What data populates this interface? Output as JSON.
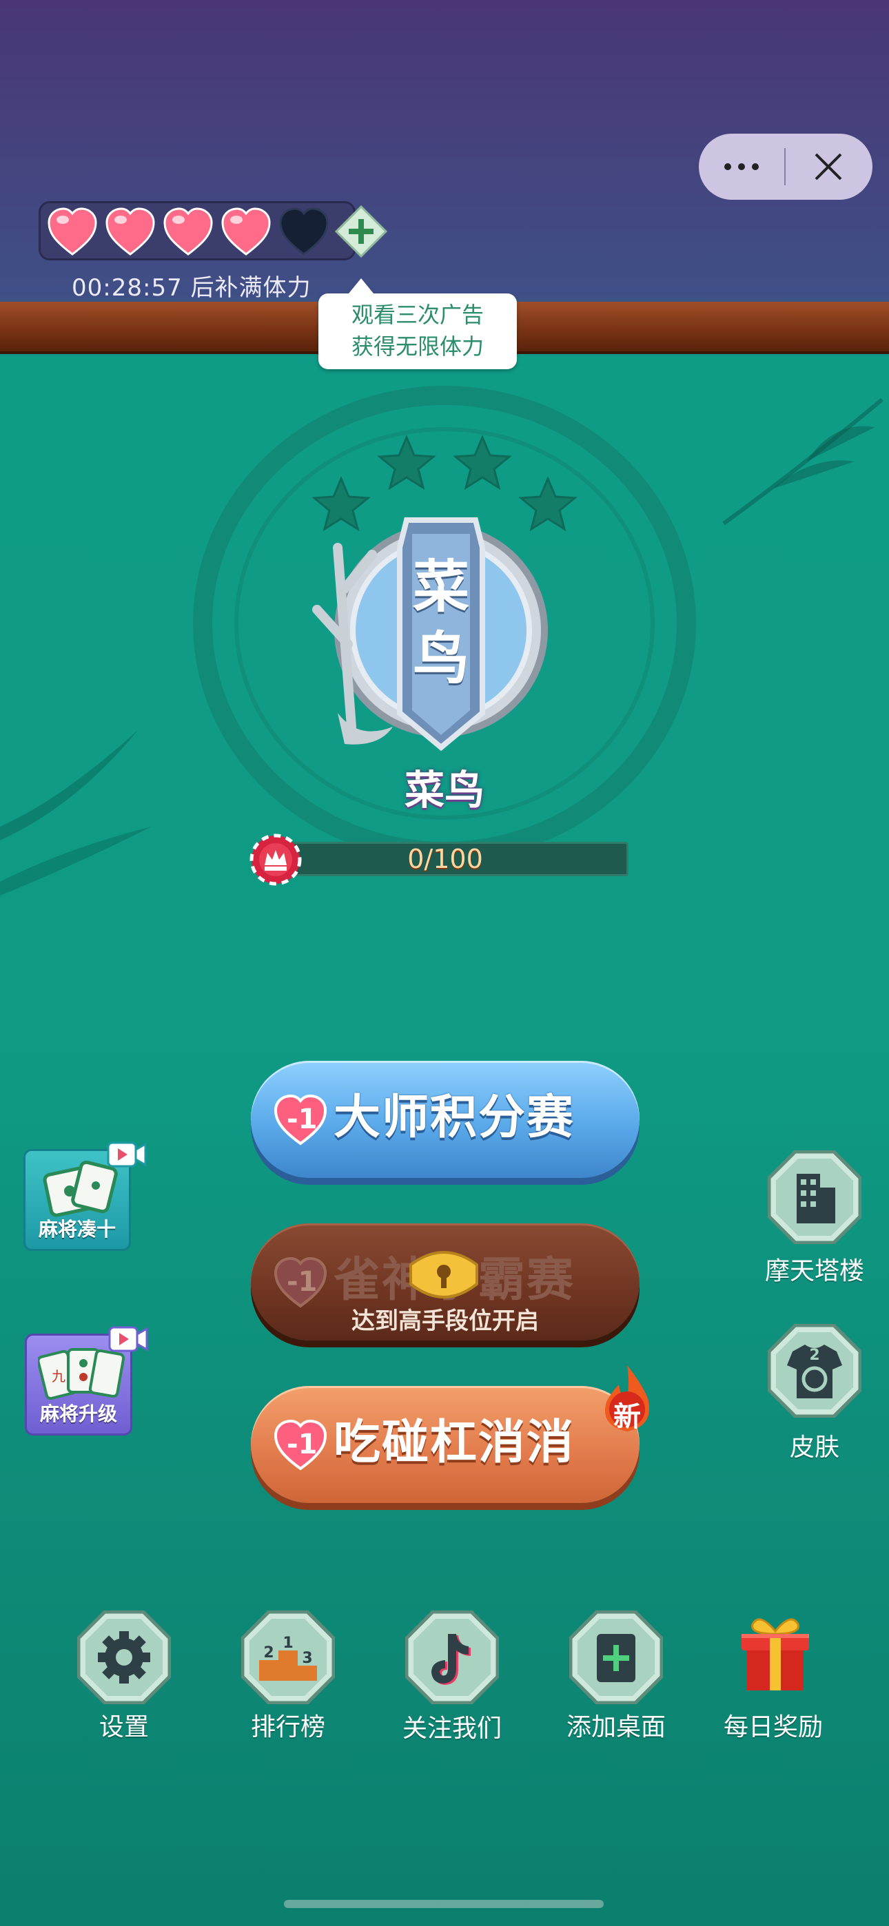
{
  "header": {
    "lives_full": 4,
    "lives_total": 5,
    "timer_text": "00:28:57 后补满体力",
    "tooltip_line1": "观看三次广告",
    "tooltip_line2": "获得无限体力"
  },
  "rank": {
    "badge_text": "菜鸟",
    "name": "菜鸟",
    "stars_total": 4,
    "stars_filled": 0,
    "progress_text": "0/100",
    "progress_value": 0
  },
  "main_buttons": {
    "master": {
      "label": "大师积分赛",
      "cost": "-1"
    },
    "locked": {
      "label": "雀神争霸赛",
      "cost": "-1",
      "sub": "达到高手段位开启"
    },
    "chi_peng": {
      "label": "吃碰杠消消",
      "cost": "-1",
      "badge": "新"
    }
  },
  "side_left": [
    {
      "label": "麻将凑十"
    },
    {
      "label": "麻将升级"
    }
  ],
  "side_right": [
    {
      "label": "摩天塔楼",
      "icon": "building-icon"
    },
    {
      "label": "皮肤",
      "icon": "skin-shirt-icon",
      "badge": "2"
    }
  ],
  "bottom_nav": [
    {
      "label": "设置",
      "icon": "gear-icon"
    },
    {
      "label": "排行榜",
      "icon": "podium-icon",
      "badge": "1 2 3"
    },
    {
      "label": "关注我们",
      "icon": "tiktok-icon"
    },
    {
      "label": "添加桌面",
      "icon": "add-desktop-icon"
    },
    {
      "label": "每日奖励",
      "icon": "gift-icon"
    }
  ],
  "colors": {
    "top_bg": "#4a3676",
    "felt": "#0f9c86",
    "heart": "#ff5f7f",
    "accent_blue": "#5aa9ea",
    "accent_orange": "#e37d4e"
  }
}
